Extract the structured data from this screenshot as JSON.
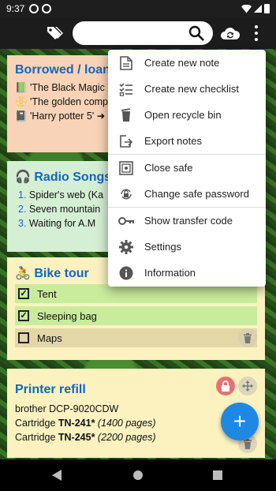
{
  "status_bar": {
    "time": "9:37"
  },
  "toolbar": {
    "search_value": ""
  },
  "notes": [
    {
      "title": "Borrowed / loan",
      "lines": [
        "📗 'The Black Magic",
        "📀 'The golden comp",
        "📓 'Harry potter 5' ➜"
      ]
    },
    {
      "title": "🎧 Radio Songs",
      "items": [
        {
          "num": "1.",
          "text": "Spider's web (Ka"
        },
        {
          "num": "2.",
          "text": "Seven mountain"
        },
        {
          "num": "3.",
          "text": "Waiting for A.M"
        }
      ]
    },
    {
      "title": "🚴 Bike tour",
      "checklist": [
        {
          "label": "Tent",
          "checked": true
        },
        {
          "label": "Sleeping bag",
          "checked": true
        },
        {
          "label": "Maps",
          "checked": false
        }
      ]
    },
    {
      "title": "Printer refill",
      "line1": "brother DCP-9020CDW",
      "line2_prefix": "Cartridge ",
      "line2_model": "TN-241*",
      "line2_note": " (1400 pages)",
      "line3_prefix": "Cartridge ",
      "line3_model": "TN-245*",
      "line3_note": " (2200 pages)"
    }
  ],
  "menu": {
    "items": [
      {
        "label": "Create new note",
        "icon": "note-icon"
      },
      {
        "label": "Create new checklist",
        "icon": "checklist-icon"
      },
      {
        "label": "Open recycle bin",
        "icon": "recycle-bin-icon"
      },
      {
        "label": "Export notes",
        "icon": "export-icon"
      },
      {
        "label": "Close safe",
        "icon": "safe-icon"
      },
      {
        "label": "Change safe password",
        "icon": "lock-change-icon"
      },
      {
        "label": "Show transfer code",
        "icon": "key-icon"
      },
      {
        "label": "Settings",
        "icon": "gear-icon"
      },
      {
        "label": "Information",
        "icon": "info-icon"
      }
    ]
  },
  "fab": {
    "symbol": "+"
  },
  "colors": {
    "accent": "#1e88e5",
    "title_blue": "#1565c0",
    "note_orange": "#f9d3b7",
    "note_green": "#d4efd4",
    "note_yellow": "#fbf2c0",
    "checked_row": "#c9ec9c"
  }
}
